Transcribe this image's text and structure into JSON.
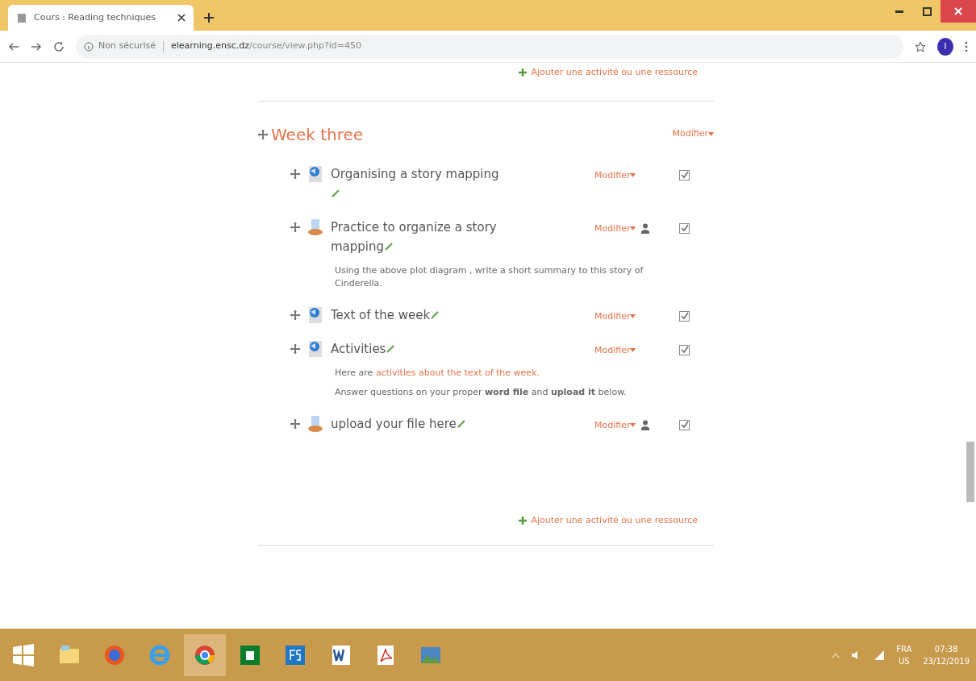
{
  "browser": {
    "tab_title": "Cours : Reading techniques",
    "security": "Non sécurisé",
    "url_host": "elearning.ensc.dz",
    "url_path": "/course/view.php?id=450",
    "profile_initial": "I"
  },
  "top_add_link": "Ajouter une activité ou une ressource",
  "section": {
    "title": "Week three",
    "edit_menu": "Modifier",
    "activities": [
      {
        "kind": "page",
        "title": "Organising a story mapping",
        "edit_menu": "Modifier",
        "user_icon": false,
        "checked": true
      },
      {
        "kind": "assign",
        "title": "Practice to organize a story mapping",
        "edit_menu": "Modifier",
        "user_icon": true,
        "checked": true,
        "description": [
          {
            "text": "Using the above plot diagram , write a short summary to this story of Cinderella."
          }
        ]
      },
      {
        "kind": "page",
        "title": "Text of the week",
        "edit_menu": "Modifier",
        "user_icon": false,
        "checked": true
      },
      {
        "kind": "page",
        "title": "Activities",
        "edit_menu": "Modifier",
        "user_icon": false,
        "checked": true,
        "description": [
          {
            "text": "Here are",
            "link": "activities about the text of the week."
          },
          {
            "text": "Answer questions on your proper **word file** and **upload it** below."
          }
        ]
      },
      {
        "kind": "assign",
        "title": "upload your file here",
        "edit_menu": "Modifier",
        "user_icon": true,
        "checked": true
      }
    ],
    "add_link": "Ajouter une activité ou une ressource"
  },
  "taskbar": {
    "apps": [
      {
        "kind": "explorer",
        "selected": false
      },
      {
        "kind": "firefox",
        "selected": false
      },
      {
        "kind": "ie",
        "selected": false
      },
      {
        "kind": "chrome",
        "selected": true
      },
      {
        "kind": "store",
        "selected": false
      },
      {
        "kind": "f5",
        "selected": false
      },
      {
        "kind": "word",
        "selected": false
      },
      {
        "kind": "pdf",
        "selected": false
      },
      {
        "kind": "photos",
        "selected": false
      }
    ],
    "language": "FRA",
    "layout": "US",
    "time": "07:38",
    "date": "23/12/2019"
  }
}
